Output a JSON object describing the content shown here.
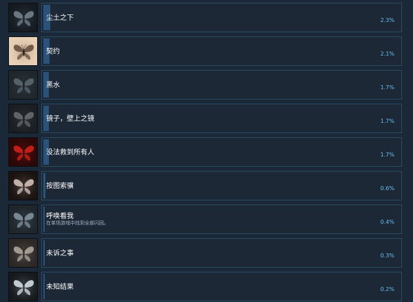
{
  "achievements": [
    {
      "title": "尘土之下",
      "description": "",
      "percent": "2.3%",
      "progress": 2.3,
      "icon": "moth-icon",
      "colors": {
        "bg": "#141a20",
        "wing": "#6d7c87"
      }
    },
    {
      "title": "契约",
      "description": "",
      "percent": "2.1%",
      "progress": 2.1,
      "icon": "moth-icon",
      "colors": {
        "bg": "#e8d1b7",
        "wing": "#6e5545"
      }
    },
    {
      "title": "黑水",
      "description": "",
      "percent": "1.7%",
      "progress": 1.7,
      "icon": "moth-icon",
      "colors": {
        "bg": "#1f262c",
        "wing": "#56646d"
      }
    },
    {
      "title": "镜子，壁上之镜",
      "description": "",
      "percent": "1.7%",
      "progress": 1.7,
      "icon": "moth-icon",
      "colors": {
        "bg": "#1a1e22",
        "wing": "#62676b"
      }
    },
    {
      "title": "没法救到所有人",
      "description": "",
      "percent": "1.7%",
      "progress": 1.7,
      "icon": "moth-icon",
      "colors": {
        "bg": "#2a0808",
        "wing": "#c8201a"
      }
    },
    {
      "title": "按图索骥",
      "description": "",
      "percent": "0.6%",
      "progress": 0.6,
      "icon": "moth-icon",
      "colors": {
        "bg": "#1a1210",
        "wing": "#c7b7b0"
      }
    },
    {
      "title": "呼唤看我",
      "description": "在单场游戏中找到全部闪回。",
      "percent": "0.4%",
      "progress": 0.4,
      "icon": "moth-icon",
      "colors": {
        "bg": "#1e252b",
        "wing": "#7c8c97"
      }
    },
    {
      "title": "未诉之事",
      "description": "",
      "percent": "0.3%",
      "progress": 0.3,
      "icon": "moth-icon",
      "colors": {
        "bg": "#2a2725",
        "wing": "#a69e97"
      }
    },
    {
      "title": "未知结果",
      "description": "",
      "percent": "0.2%",
      "progress": 0.2,
      "icon": "moth-icon",
      "colors": {
        "bg": "#15191c",
        "wing": "#c9d3d9"
      }
    }
  ],
  "colors": {
    "accent": "#66c0f4",
    "panel_border": "#2b4b62",
    "progress_fill": "#2b5278"
  }
}
